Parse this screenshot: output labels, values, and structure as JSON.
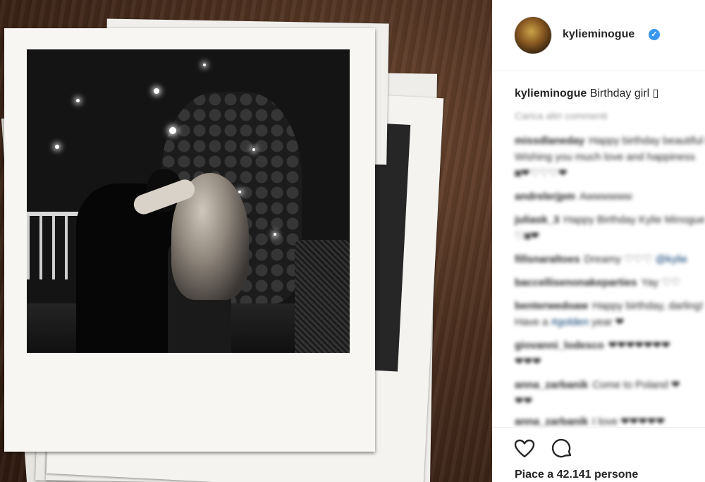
{
  "post": {
    "username": "kylieminogue",
    "verified_symbol": "✓",
    "caption": {
      "user": "kylieminogue",
      "text": "Birthday girl ▯"
    },
    "load_more": "Carica altri commenti",
    "comments": [
      {
        "user": "missdlaneday",
        "text": "Happy birthday beautiful Kylie!"
      },
      {
        "user": "",
        "text": "Wishing you much love and happiness"
      },
      {
        "user": "",
        "text": "◙❤♡♡♡❤"
      },
      {
        "user": "andrelerjpm",
        "text": "Awwwwww"
      },
      {
        "user": "juliask_3",
        "text": "Happy Birthday Kylie Minogue"
      },
      {
        "user": "",
        "text": "♡◙❤"
      },
      {
        "user": "fillsnaraltoes",
        "text": "Dreamy ♡♡♡",
        "mention": "@kylie"
      },
      {
        "user": "baccellisenonakeparties",
        "text": "Yay ♡♡"
      },
      {
        "user": "benterwedoaw",
        "text": "Happy birthday, darling!"
      },
      {
        "user": "",
        "text": "Have a",
        "mention": "#golden",
        "after": "year ❤"
      },
      {
        "user": "giovanni_lodesco",
        "text": "❤❤❤❤❤❤❤"
      },
      {
        "user": "",
        "text": "❤❤❤"
      },
      {
        "user": "anna_zarbanik",
        "text": "Come to Poland ❤"
      },
      {
        "user": "",
        "text": "❤❤"
      },
      {
        "user": "anna_zarbanik",
        "text": "I love ❤❤❤❤❤"
      }
    ],
    "likes": "Piace a 42.141 persone",
    "icons": {
      "like": "heart-icon",
      "comment": "comment-icon"
    }
  }
}
